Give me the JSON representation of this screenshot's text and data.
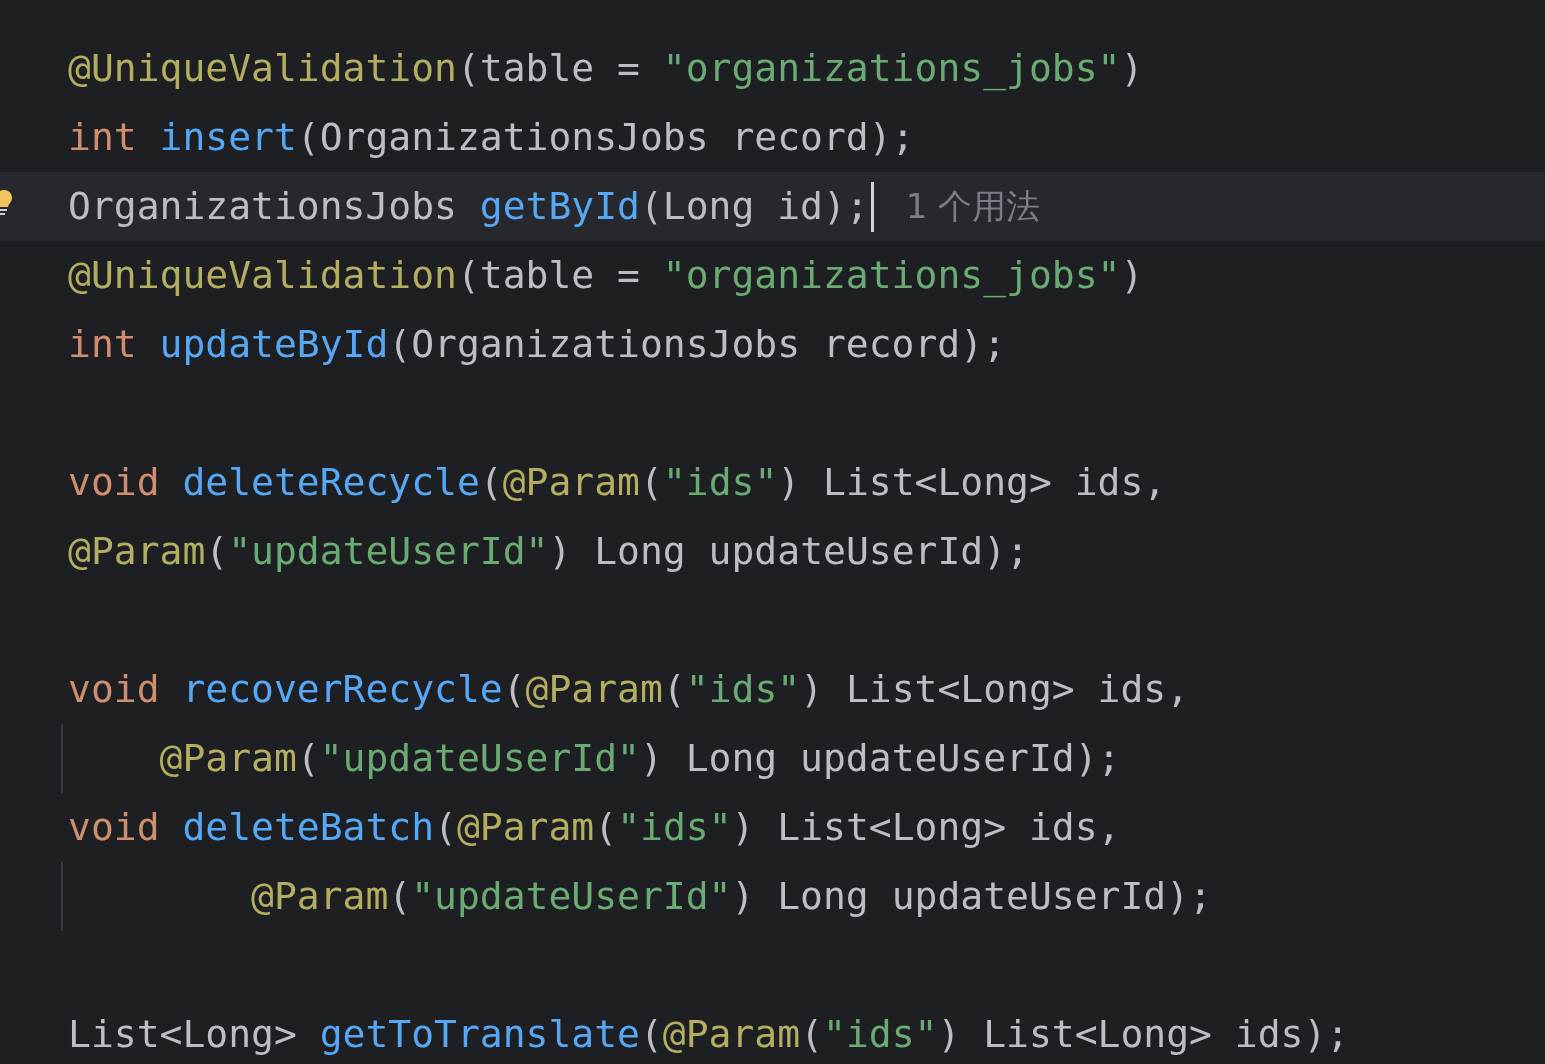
{
  "editor": {
    "lines": [
      {
        "kind": "code",
        "current": false,
        "tokens": [
          {
            "kind": "annotation",
            "text": "@UniqueValidation"
          },
          {
            "kind": "plain",
            "text": "(table = "
          },
          {
            "kind": "string",
            "text": "\"organizations_jobs\""
          },
          {
            "kind": "plain",
            "text": ")"
          }
        ]
      },
      {
        "kind": "code",
        "current": false,
        "tokens": [
          {
            "kind": "keyword",
            "text": "int "
          },
          {
            "kind": "function",
            "text": "insert"
          },
          {
            "kind": "plain",
            "text": "(OrganizationsJobs record);"
          }
        ]
      },
      {
        "kind": "code",
        "current": true,
        "hint": "1 个用法",
        "tokens": [
          {
            "kind": "plain",
            "text": "OrganizationsJobs "
          },
          {
            "kind": "function",
            "text": "getById"
          },
          {
            "kind": "plain",
            "text": "(Long id);"
          }
        ]
      },
      {
        "kind": "code",
        "current": false,
        "tokens": [
          {
            "kind": "annotation",
            "text": "@UniqueValidation"
          },
          {
            "kind": "plain",
            "text": "(table = "
          },
          {
            "kind": "string",
            "text": "\"organizations_jobs\""
          },
          {
            "kind": "plain",
            "text": ")"
          }
        ]
      },
      {
        "kind": "code",
        "current": false,
        "tokens": [
          {
            "kind": "keyword",
            "text": "int "
          },
          {
            "kind": "function",
            "text": "updateById"
          },
          {
            "kind": "plain",
            "text": "(OrganizationsJobs record);"
          }
        ]
      },
      {
        "kind": "blank",
        "current": false
      },
      {
        "kind": "code",
        "current": false,
        "tokens": [
          {
            "kind": "keyword",
            "text": "void "
          },
          {
            "kind": "function",
            "text": "deleteRecycle"
          },
          {
            "kind": "plain",
            "text": "("
          },
          {
            "kind": "annotation",
            "text": "@Param"
          },
          {
            "kind": "plain",
            "text": "("
          },
          {
            "kind": "string",
            "text": "\"ids\""
          },
          {
            "kind": "plain",
            "text": ") List<Long> ids,"
          }
        ]
      },
      {
        "kind": "code",
        "current": false,
        "tokens": [
          {
            "kind": "annotation",
            "text": "@Param"
          },
          {
            "kind": "plain",
            "text": "("
          },
          {
            "kind": "string",
            "text": "\"updateUserId\""
          },
          {
            "kind": "plain",
            "text": ") Long updateUserId);"
          }
        ]
      },
      {
        "kind": "blank",
        "current": false
      },
      {
        "kind": "code",
        "current": false,
        "tokens": [
          {
            "kind": "keyword",
            "text": "void "
          },
          {
            "kind": "function",
            "text": "recoverRecycle"
          },
          {
            "kind": "plain",
            "text": "("
          },
          {
            "kind": "annotation",
            "text": "@Param"
          },
          {
            "kind": "plain",
            "text": "("
          },
          {
            "kind": "string",
            "text": "\"ids\""
          },
          {
            "kind": "plain",
            "text": ") List<Long> ids,"
          }
        ]
      },
      {
        "kind": "indented",
        "current": false,
        "tokens": [
          {
            "kind": "annotation",
            "text": "@Param"
          },
          {
            "kind": "plain",
            "text": "("
          },
          {
            "kind": "string",
            "text": "\"updateUserId\""
          },
          {
            "kind": "plain",
            "text": ") Long updateUserId);"
          }
        ]
      },
      {
        "kind": "code",
        "current": false,
        "tokens": [
          {
            "kind": "keyword",
            "text": "void "
          },
          {
            "kind": "function",
            "text": "deleteBatch"
          },
          {
            "kind": "plain",
            "text": "("
          },
          {
            "kind": "annotation",
            "text": "@Param"
          },
          {
            "kind": "plain",
            "text": "("
          },
          {
            "kind": "string",
            "text": "\"ids\""
          },
          {
            "kind": "plain",
            "text": ") List<Long> ids,"
          }
        ]
      },
      {
        "kind": "double_indented",
        "current": false,
        "tokens": [
          {
            "kind": "annotation",
            "text": "@Param"
          },
          {
            "kind": "plain",
            "text": "("
          },
          {
            "kind": "string",
            "text": "\"updateUserId\""
          },
          {
            "kind": "plain",
            "text": ") Long updateUserId);"
          }
        ]
      },
      {
        "kind": "blank",
        "current": false
      },
      {
        "kind": "code",
        "current": false,
        "tokens": [
          {
            "kind": "plain",
            "text": "List<Long> "
          },
          {
            "kind": "function",
            "text": "getToTranslate"
          },
          {
            "kind": "plain",
            "text": "("
          },
          {
            "kind": "annotation",
            "text": "@Param"
          },
          {
            "kind": "plain",
            "text": "("
          },
          {
            "kind": "string",
            "text": "\"ids\""
          },
          {
            "kind": "plain",
            "text": ") List<Long> ids);"
          }
        ]
      }
    ]
  }
}
